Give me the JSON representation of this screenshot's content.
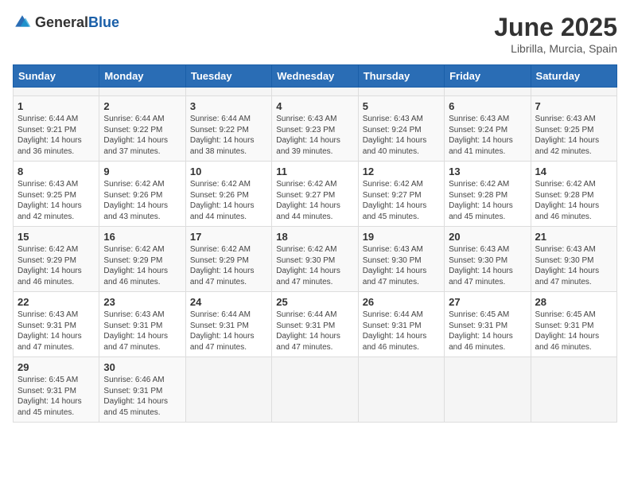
{
  "header": {
    "logo_general": "General",
    "logo_blue": "Blue",
    "title": "June 2025",
    "subtitle": "Librilla, Murcia, Spain"
  },
  "calendar": {
    "days_of_week": [
      "Sunday",
      "Monday",
      "Tuesday",
      "Wednesday",
      "Thursday",
      "Friday",
      "Saturday"
    ],
    "weeks": [
      [
        {
          "day": "",
          "empty": true
        },
        {
          "day": "",
          "empty": true
        },
        {
          "day": "",
          "empty": true
        },
        {
          "day": "",
          "empty": true
        },
        {
          "day": "",
          "empty": true
        },
        {
          "day": "",
          "empty": true
        },
        {
          "day": "",
          "empty": true
        }
      ],
      [
        {
          "day": "1",
          "sunrise": "6:44 AM",
          "sunset": "9:21 PM",
          "daylight": "14 hours and 36 minutes."
        },
        {
          "day": "2",
          "sunrise": "6:44 AM",
          "sunset": "9:22 PM",
          "daylight": "14 hours and 37 minutes."
        },
        {
          "day": "3",
          "sunrise": "6:44 AM",
          "sunset": "9:22 PM",
          "daylight": "14 hours and 38 minutes."
        },
        {
          "day": "4",
          "sunrise": "6:43 AM",
          "sunset": "9:23 PM",
          "daylight": "14 hours and 39 minutes."
        },
        {
          "day": "5",
          "sunrise": "6:43 AM",
          "sunset": "9:24 PM",
          "daylight": "14 hours and 40 minutes."
        },
        {
          "day": "6",
          "sunrise": "6:43 AM",
          "sunset": "9:24 PM",
          "daylight": "14 hours and 41 minutes."
        },
        {
          "day": "7",
          "sunrise": "6:43 AM",
          "sunset": "9:25 PM",
          "daylight": "14 hours and 42 minutes."
        }
      ],
      [
        {
          "day": "8",
          "sunrise": "6:43 AM",
          "sunset": "9:25 PM",
          "daylight": "14 hours and 42 minutes."
        },
        {
          "day": "9",
          "sunrise": "6:42 AM",
          "sunset": "9:26 PM",
          "daylight": "14 hours and 43 minutes."
        },
        {
          "day": "10",
          "sunrise": "6:42 AM",
          "sunset": "9:26 PM",
          "daylight": "14 hours and 44 minutes."
        },
        {
          "day": "11",
          "sunrise": "6:42 AM",
          "sunset": "9:27 PM",
          "daylight": "14 hours and 44 minutes."
        },
        {
          "day": "12",
          "sunrise": "6:42 AM",
          "sunset": "9:27 PM",
          "daylight": "14 hours and 45 minutes."
        },
        {
          "day": "13",
          "sunrise": "6:42 AM",
          "sunset": "9:28 PM",
          "daylight": "14 hours and 45 minutes."
        },
        {
          "day": "14",
          "sunrise": "6:42 AM",
          "sunset": "9:28 PM",
          "daylight": "14 hours and 46 minutes."
        }
      ],
      [
        {
          "day": "15",
          "sunrise": "6:42 AM",
          "sunset": "9:29 PM",
          "daylight": "14 hours and 46 minutes."
        },
        {
          "day": "16",
          "sunrise": "6:42 AM",
          "sunset": "9:29 PM",
          "daylight": "14 hours and 46 minutes."
        },
        {
          "day": "17",
          "sunrise": "6:42 AM",
          "sunset": "9:29 PM",
          "daylight": "14 hours and 47 minutes."
        },
        {
          "day": "18",
          "sunrise": "6:42 AM",
          "sunset": "9:30 PM",
          "daylight": "14 hours and 47 minutes."
        },
        {
          "day": "19",
          "sunrise": "6:43 AM",
          "sunset": "9:30 PM",
          "daylight": "14 hours and 47 minutes."
        },
        {
          "day": "20",
          "sunrise": "6:43 AM",
          "sunset": "9:30 PM",
          "daylight": "14 hours and 47 minutes."
        },
        {
          "day": "21",
          "sunrise": "6:43 AM",
          "sunset": "9:30 PM",
          "daylight": "14 hours and 47 minutes."
        }
      ],
      [
        {
          "day": "22",
          "sunrise": "6:43 AM",
          "sunset": "9:31 PM",
          "daylight": "14 hours and 47 minutes."
        },
        {
          "day": "23",
          "sunrise": "6:43 AM",
          "sunset": "9:31 PM",
          "daylight": "14 hours and 47 minutes."
        },
        {
          "day": "24",
          "sunrise": "6:44 AM",
          "sunset": "9:31 PM",
          "daylight": "14 hours and 47 minutes."
        },
        {
          "day": "25",
          "sunrise": "6:44 AM",
          "sunset": "9:31 PM",
          "daylight": "14 hours and 47 minutes."
        },
        {
          "day": "26",
          "sunrise": "6:44 AM",
          "sunset": "9:31 PM",
          "daylight": "14 hours and 46 minutes."
        },
        {
          "day": "27",
          "sunrise": "6:45 AM",
          "sunset": "9:31 PM",
          "daylight": "14 hours and 46 minutes."
        },
        {
          "day": "28",
          "sunrise": "6:45 AM",
          "sunset": "9:31 PM",
          "daylight": "14 hours and 46 minutes."
        }
      ],
      [
        {
          "day": "29",
          "sunrise": "6:45 AM",
          "sunset": "9:31 PM",
          "daylight": "14 hours and 45 minutes."
        },
        {
          "day": "30",
          "sunrise": "6:46 AM",
          "sunset": "9:31 PM",
          "daylight": "14 hours and 45 minutes."
        },
        {
          "day": "",
          "empty": true
        },
        {
          "day": "",
          "empty": true
        },
        {
          "day": "",
          "empty": true
        },
        {
          "day": "",
          "empty": true
        },
        {
          "day": "",
          "empty": true
        }
      ]
    ]
  }
}
